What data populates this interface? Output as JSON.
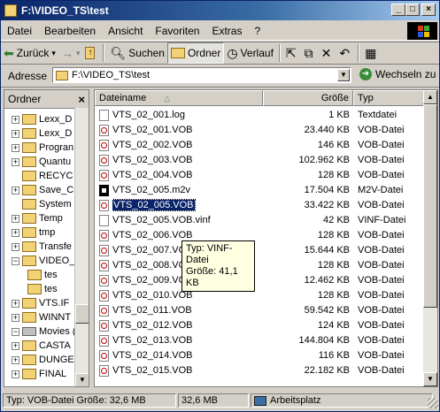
{
  "window": {
    "title": "F:\\VIDEO_TS\\test",
    "min": "_",
    "max": "□",
    "close": "×"
  },
  "menu": [
    "Datei",
    "Bearbeiten",
    "Ansicht",
    "Favoriten",
    "Extras",
    "?"
  ],
  "toolbar": {
    "back": "Zurück",
    "back_dd": "▾",
    "forward": "→",
    "forward_dd": "▾",
    "up": "↑",
    "search": "Suchen",
    "folders": "Ordner",
    "history": "Verlauf",
    "move": "⇱",
    "copy": "⧉",
    "delete": "✕",
    "undo": "↶",
    "views": "▦"
  },
  "address": {
    "label": "Adresse",
    "value": "F:\\VIDEO_TS\\test",
    "go": "Wechseln zu"
  },
  "tree": {
    "header": "Ordner",
    "close": "×",
    "items": [
      {
        "pm": "+",
        "indent": 1,
        "label": "Lexx_D"
      },
      {
        "pm": "+",
        "indent": 1,
        "label": "Lexx_D"
      },
      {
        "pm": "+",
        "indent": 1,
        "label": "Progran"
      },
      {
        "pm": "+",
        "indent": 1,
        "label": "Quantu"
      },
      {
        "pm": "",
        "indent": 1,
        "label": "RECYC"
      },
      {
        "pm": "+",
        "indent": 1,
        "label": "Save_C"
      },
      {
        "pm": "",
        "indent": 1,
        "label": "System"
      },
      {
        "pm": "+",
        "indent": 1,
        "label": "Temp"
      },
      {
        "pm": "+",
        "indent": 1,
        "label": "tmp"
      },
      {
        "pm": "+",
        "indent": 1,
        "label": "Transfe"
      },
      {
        "pm": "−",
        "indent": 1,
        "label": "VIDEO_"
      },
      {
        "pm": "",
        "indent": 2,
        "label": "tes"
      },
      {
        "pm": "",
        "indent": 2,
        "label": "tes"
      },
      {
        "pm": "+",
        "indent": 1,
        "label": "VTS.IF"
      },
      {
        "pm": "+",
        "indent": 1,
        "label": "WINNT"
      },
      {
        "pm": "−",
        "indent": 0,
        "label": "Movies (G:",
        "drive": true
      },
      {
        "pm": "+",
        "indent": 1,
        "label": "CASTA"
      },
      {
        "pm": "+",
        "indent": 1,
        "label": "DUNGE"
      },
      {
        "pm": "+",
        "indent": 1,
        "label": "FINAL"
      }
    ]
  },
  "list": {
    "columns": {
      "name": "Dateiname",
      "size": "Größe",
      "type": "Typ",
      "sort_indicator": "△"
    },
    "files": [
      {
        "name": "VTS_02_001.log",
        "size": "1 KB",
        "type": "Textdatei",
        "icon": "txt"
      },
      {
        "name": "VTS_02_001.VOB",
        "size": "23.440 KB",
        "type": "VOB-Datei",
        "icon": "vob"
      },
      {
        "name": "VTS_02_002.VOB",
        "size": "146 KB",
        "type": "VOB-Datei",
        "icon": "vob"
      },
      {
        "name": "VTS_02_003.VOB",
        "size": "102.962 KB",
        "type": "VOB-Datei",
        "icon": "vob"
      },
      {
        "name": "VTS_02_004.VOB",
        "size": "128 KB",
        "type": "VOB-Datei",
        "icon": "vob"
      },
      {
        "name": "VTS_02_005.m2v",
        "size": "17.504 KB",
        "type": "M2V-Datei",
        "icon": "m2v"
      },
      {
        "name": "VTS_02_005.VOB",
        "size": "33.422 KB",
        "type": "VOB-Datei",
        "icon": "vob",
        "selected": true
      },
      {
        "name": "VTS_02_005.VOB.vinf",
        "size": "42 KB",
        "type": "VINF-Datei",
        "icon": "txt"
      },
      {
        "name": "VTS_02_006.VOB",
        "size": "128 KB",
        "type": "VOB-Datei",
        "icon": "vob"
      },
      {
        "name": "VTS_02_007.VOB",
        "size": "15.644 KB",
        "type": "VOB-Datei",
        "icon": "vob"
      },
      {
        "name": "VTS_02_008.VOB",
        "size": "128 KB",
        "type": "VOB-Datei",
        "icon": "vob"
      },
      {
        "name": "VTS_02_009.VOB",
        "size": "12.462 KB",
        "type": "VOB-Datei",
        "icon": "vob"
      },
      {
        "name": "VTS_02_010.VOB",
        "size": "128 KB",
        "type": "VOB-Datei",
        "icon": "vob"
      },
      {
        "name": "VTS_02_011.VOB",
        "size": "59.542 KB",
        "type": "VOB-Datei",
        "icon": "vob"
      },
      {
        "name": "VTS_02_012.VOB",
        "size": "124 KB",
        "type": "VOB-Datei",
        "icon": "vob"
      },
      {
        "name": "VTS_02_013.VOB",
        "size": "144.804 KB",
        "type": "VOB-Datei",
        "icon": "vob"
      },
      {
        "name": "VTS_02_014.VOB",
        "size": "116 KB",
        "type": "VOB-Datei",
        "icon": "vob"
      },
      {
        "name": "VTS_02_015.VOB",
        "size": "22.182 KB",
        "type": "VOB-Datei",
        "icon": "vob"
      }
    ]
  },
  "tooltip": {
    "line1": "Typ: VINF-Datei",
    "line2": "Größe: 41,1 KB"
  },
  "status": {
    "info": "Typ: VOB-Datei Größe: 32,6 MB",
    "size": "32,6 MB",
    "zone": "Arbeitsplatz"
  }
}
